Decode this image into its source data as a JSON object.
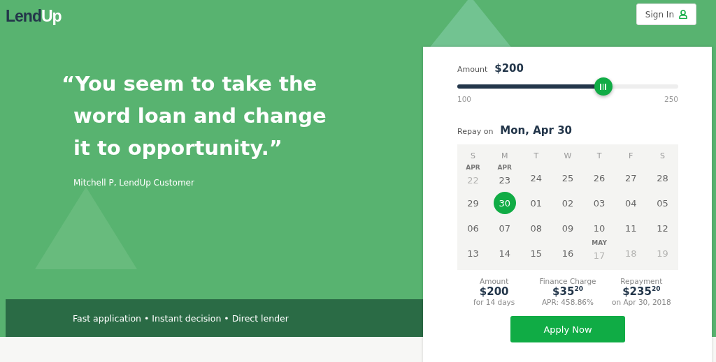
{
  "logo": {
    "dark_part": "Lend",
    "light_part": "Up"
  },
  "sign_in": {
    "label": "Sign In"
  },
  "hero": {
    "quote": "“You seem to take the\nword loan and change\nit to opportunity.”",
    "attribution": "Mitchell P, LendUp Customer"
  },
  "features": "Fast application • Instant decision • Direct lender",
  "loan_card": {
    "amount": {
      "label": "Amount",
      "value": "$200",
      "level": 0.66,
      "min": "100",
      "max": "250"
    },
    "repay": {
      "label": "Repay on",
      "value": "Mon, Apr 30"
    },
    "weekdays": [
      "S",
      "M",
      "T",
      "W",
      "T",
      "F",
      "S"
    ],
    "weeks": [
      [
        {
          "day": "22",
          "month": "APR",
          "disabled": true,
          "selected": false
        },
        {
          "day": "23",
          "month": "APR",
          "disabled": false,
          "selected": false
        },
        {
          "day": "24",
          "disabled": false,
          "selected": false
        },
        {
          "day": "25",
          "disabled": false,
          "selected": false
        },
        {
          "day": "26",
          "disabled": false,
          "selected": false
        },
        {
          "day": "27",
          "disabled": false,
          "selected": false
        },
        {
          "day": "28",
          "disabled": false,
          "selected": false
        }
      ],
      [
        {
          "day": "29",
          "disabled": false,
          "selected": false
        },
        {
          "day": "30",
          "disabled": false,
          "selected": true
        },
        {
          "day": "01",
          "disabled": false,
          "selected": false
        },
        {
          "day": "02",
          "disabled": false,
          "selected": false
        },
        {
          "day": "03",
          "disabled": false,
          "selected": false
        },
        {
          "day": "04",
          "disabled": false,
          "selected": false
        },
        {
          "day": "05",
          "disabled": false,
          "selected": false
        }
      ],
      [
        {
          "day": "06",
          "disabled": false,
          "selected": false
        },
        {
          "day": "07",
          "disabled": false,
          "selected": false
        },
        {
          "day": "08",
          "disabled": false,
          "selected": false
        },
        {
          "day": "09",
          "disabled": false,
          "selected": false
        },
        {
          "day": "10",
          "disabled": false,
          "selected": false
        },
        {
          "day": "11",
          "disabled": false,
          "selected": false
        },
        {
          "day": "12",
          "disabled": false,
          "selected": false
        }
      ],
      [
        {
          "day": "13",
          "disabled": false,
          "selected": false
        },
        {
          "day": "14",
          "disabled": false,
          "selected": false
        },
        {
          "day": "15",
          "disabled": false,
          "selected": false
        },
        {
          "day": "16",
          "disabled": false,
          "selected": false
        },
        {
          "day": "17",
          "month": "MAY",
          "disabled": true,
          "selected": false
        },
        {
          "day": "18",
          "disabled": true,
          "selected": false
        },
        {
          "day": "19",
          "disabled": true,
          "selected": false
        }
      ]
    ],
    "summary": [
      {
        "label": "Amount",
        "value": "$200",
        "note": "for 14 days"
      },
      {
        "label": "Finance Charge",
        "value": "$35$^{20}$",
        "note": "APR: 458.86%"
      },
      {
        "label": "Repayment",
        "value": "$235$^{20}$",
        "note": "on Apr 30, 2018"
      }
    ],
    "apply": {
      "label": "Apply Now"
    }
  }
}
